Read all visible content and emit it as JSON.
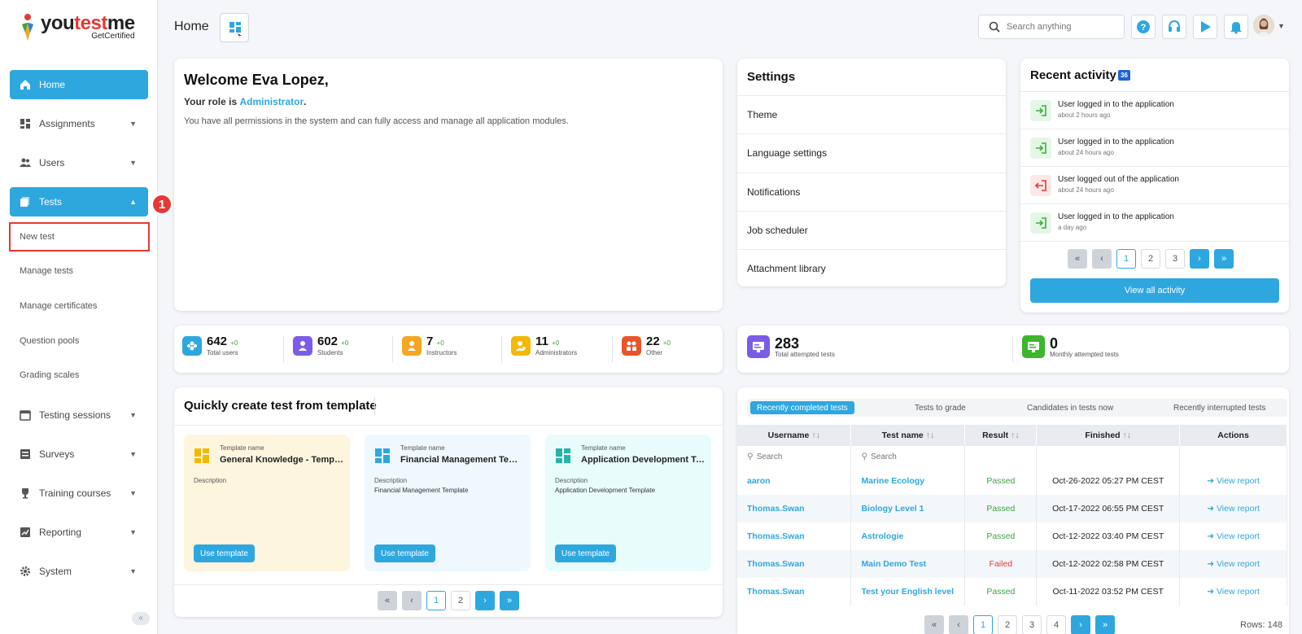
{
  "logo": {
    "word1": "you",
    "word2": "test",
    "word3": "me",
    "sub": "GetCertified"
  },
  "sidebar": {
    "items": [
      {
        "label": "Home"
      },
      {
        "label": "Assignments"
      },
      {
        "label": "Users"
      },
      {
        "label": "Tests"
      },
      {
        "label": "Testing sessions"
      },
      {
        "label": "Surveys"
      },
      {
        "label": "Training courses"
      },
      {
        "label": "Reporting"
      },
      {
        "label": "System"
      }
    ],
    "sub_items": [
      "New test",
      "Manage tests",
      "Manage certificates",
      "Question pools",
      "Grading scales"
    ],
    "badge": "1",
    "collapse": "«"
  },
  "header": {
    "title": "Home",
    "search_placeholder": "Search anything"
  },
  "welcome": {
    "title": "Welcome Eva Lopez,",
    "role_prefix": "Your role is ",
    "role": "Administrator",
    "role_suffix": ".",
    "desc": "You have all permissions in the system and can fully access and manage all application modules."
  },
  "settings": {
    "title": "Settings",
    "items": [
      "Theme",
      "Language settings",
      "Notifications",
      "Job scheduler",
      "Attachment library"
    ]
  },
  "recent": {
    "title": "Recent activity",
    "count": "36",
    "items": [
      {
        "text": "User logged in to the application",
        "time": "about 2 hours ago",
        "type": "in"
      },
      {
        "text": "User logged in to the application",
        "time": "about 24 hours ago",
        "type": "in"
      },
      {
        "text": "User logged out of the application",
        "time": "about 24 hours ago",
        "type": "out"
      },
      {
        "text": "User logged in to the application",
        "time": "a day ago",
        "type": "in"
      }
    ],
    "pages": [
      "1",
      "2",
      "3"
    ],
    "view_all": "View all activity"
  },
  "stats": [
    {
      "num": "642",
      "plus": "+0",
      "label": "Total users",
      "color": "#2ea7df"
    },
    {
      "num": "602",
      "plus": "+0",
      "label": "Students",
      "color": "#7b5ce6"
    },
    {
      "num": "7",
      "plus": "+0",
      "label": "Instructors",
      "color": "#f5a623"
    },
    {
      "num": "11",
      "plus": "+0",
      "label": "Administrators",
      "color": "#f5b800"
    },
    {
      "num": "22",
      "plus": "+0",
      "label": "Other",
      "color": "#e8542c"
    }
  ],
  "attempts": [
    {
      "num": "283",
      "label": "Total attempted tests",
      "color": "#7b5ce6"
    },
    {
      "num": "0",
      "label": "Monthly attempted tests",
      "color": "#3cb62c"
    }
  ],
  "templates": {
    "title": "Quickly create test from template",
    "name_label": "Template name",
    "desc_label": "Description",
    "use_label": "Use template",
    "items": [
      {
        "name": "General Knowledge - Template",
        "desc": "",
        "bg": "#fef5df",
        "icon": "#f5b800"
      },
      {
        "name": "Financial Management Template",
        "desc": "Financial Management Template",
        "bg": "#eef8fe",
        "icon": "#2ea7df"
      },
      {
        "name": "Application Development Template",
        "desc": "Application Development Template",
        "bg": "#e9fcfc",
        "icon": "#26b3a8"
      }
    ],
    "pages": [
      "1",
      "2"
    ]
  },
  "tests_panel": {
    "tabs": [
      "Recently completed tests",
      "Tests to grade",
      "Candidates in tests now",
      "Recently interrupted tests"
    ],
    "columns": [
      "Username",
      "Test name",
      "Result",
      "Finished",
      "Actions"
    ],
    "search_placeholder": "Search",
    "rows": [
      {
        "user": "aaron",
        "test": "Marine Ecology",
        "result": "Passed",
        "finished": "Oct-26-2022 05:27 PM CEST",
        "action": "View report"
      },
      {
        "user": "Thomas.Swan",
        "test": "Biology Level 1",
        "result": "Passed",
        "finished": "Oct-17-2022 06:55 PM CEST",
        "action": "View report"
      },
      {
        "user": "Thomas.Swan",
        "test": "Astrologie",
        "result": "Passed",
        "finished": "Oct-12-2022 03:40 PM CEST",
        "action": "View report"
      },
      {
        "user": "Thomas.Swan",
        "test": "Main Demo Test",
        "result": "Failed",
        "finished": "Oct-12-2022 02:58 PM CEST",
        "action": "View report"
      },
      {
        "user": "Thomas.Swan",
        "test": "Test your English level",
        "result": "Passed",
        "finished": "Oct-11-2022 03:52 PM CEST",
        "action": "View report"
      }
    ],
    "pages": [
      "1",
      "2",
      "3",
      "4"
    ],
    "rows_label": "Rows: 148"
  },
  "colors": {
    "accent": "#2ea7df",
    "danger": "#e53935",
    "success": "#43a047"
  }
}
